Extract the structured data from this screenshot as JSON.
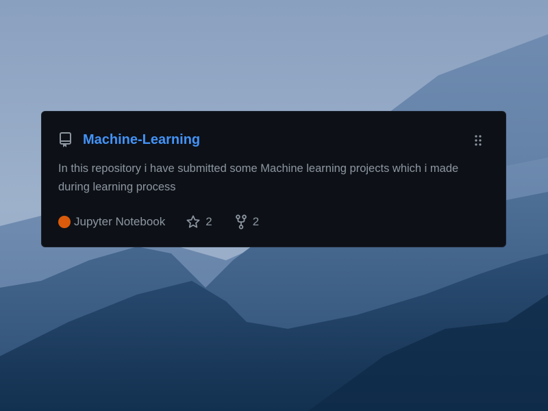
{
  "background": {
    "description_icon": "mountain-landscape"
  },
  "card": {
    "repo_icon": "repo-book-icon",
    "repo_name": "Machine-Learning",
    "repo_link_color": "#4493f8",
    "drag_icon": "drag-grip-icon",
    "description": "In this repository i have submitted some Machine learning projects which i made during learning process",
    "language": {
      "name": "Jupyter Notebook",
      "color": "#DA5B0B"
    },
    "stars": {
      "icon": "star-icon",
      "count": "2"
    },
    "forks": {
      "icon": "fork-icon",
      "count": "2"
    }
  }
}
